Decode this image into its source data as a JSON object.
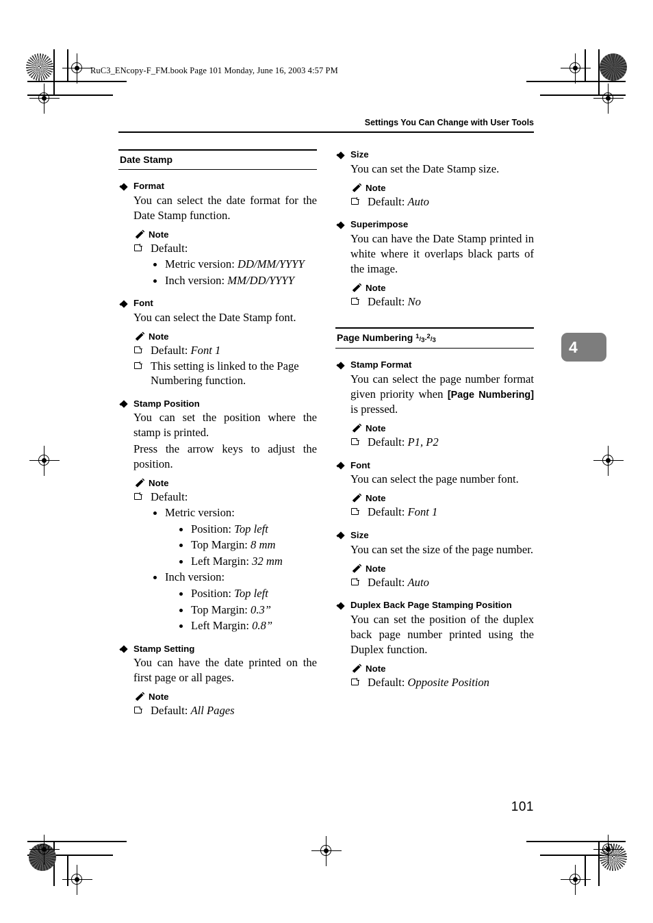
{
  "print_marks": {
    "file_info": "RuC3_ENcopy-F_FM.book  Page 101  Monday, June 16, 2003  4:57 PM"
  },
  "running_head": "Settings You Can Change with User Tools",
  "chapter_tab": "4",
  "folio": "101",
  "labels": {
    "note": "Note",
    "default_prefix": "Default:"
  },
  "left_column": {
    "section_title": "Date Stamp",
    "items": [
      {
        "title": "Format",
        "body": "You can select the date format for the Date Stamp function.",
        "note_lines": [
          "Default:"
        ],
        "sub_bullets": [
          {
            "text": "Metric version: ",
            "value": "DD/MM/YYYY"
          },
          {
            "text": "Inch version: ",
            "value": "MM/DD/YYYY"
          }
        ]
      },
      {
        "title": "Font",
        "body": "You can select the Date Stamp font.",
        "note_lines": [
          "Default: Font 1",
          "This setting is linked to the Page Numbering function."
        ]
      },
      {
        "title": "Stamp Position",
        "body": "You can set the position where the stamp is printed.\nPress the arrow keys to adjust the position.",
        "note_lines": [
          "Default:"
        ]
      },
      {
        "title": "Stamp Setting",
        "body": "You can have the date printed on the first page or all pages.",
        "note_lines": [
          "Default: All Pages"
        ]
      }
    ],
    "format_note_label": "Default:",
    "format_sub": [
      {
        "label": "Metric version: ",
        "value": "DD/MM/YYYY"
      },
      {
        "label": "Inch version: ",
        "value": "MM/DD/YYYY"
      }
    ],
    "font_note_1_label": "Default: ",
    "font_note_1_value": "Font 1",
    "font_note_2": "This setting is linked to the Page Numbering function.",
    "stamp_position_body_1": "You can set the position where the stamp is printed.",
    "stamp_position_body_2": "Press the arrow keys to adjust the position.",
    "stamp_position_default_label": "Default:",
    "stamp_position_versions": [
      {
        "label": "Metric version:",
        "entries": [
          {
            "label": "Position: ",
            "value": "Top left"
          },
          {
            "label": "Top Margin: ",
            "value": "8 mm"
          },
          {
            "label": "Left Margin: ",
            "value": "32 mm"
          }
        ]
      },
      {
        "label": "Inch version:",
        "entries": [
          {
            "label": "Position: ",
            "value": "Top left"
          },
          {
            "label": "Top Margin: ",
            "value": "0.3”"
          },
          {
            "label": "Left Margin: ",
            "value": "0.8”"
          }
        ]
      }
    ],
    "stamp_setting_note_label": "Default: ",
    "stamp_setting_note_value": "All Pages"
  },
  "right_column": {
    "size_title": "Size",
    "size_body": "You can set the Date Stamp size.",
    "size_note_label": "Default: ",
    "size_note_value": "Auto",
    "superimpose_title": "Superimpose",
    "superimpose_body": "You can have the Date Stamp printed in white where it overlaps black parts of the image.",
    "superimpose_note_label": "Default: ",
    "superimpose_note_value": "No",
    "section_title": "Page Numbering",
    "section_title_fraction_1_num": "1",
    "section_title_fraction_1_den": "3",
    "section_title_separator": "-",
    "section_title_fraction_2_num": "2",
    "section_title_fraction_2_den": "3",
    "stamp_format_title": "Stamp Format",
    "stamp_format_body_before": "You can select the page number format given priority when ",
    "stamp_format_body_key": "[Page Numbering]",
    "stamp_format_body_after": " is pressed.",
    "stamp_format_note_label": "Default: ",
    "stamp_format_note_value": "P1, P2",
    "font_title": "Font",
    "font_body": "You can select the page number font.",
    "font_note_label": "Default: ",
    "font_note_value": "Font 1",
    "pn_size_title": "Size",
    "pn_size_body": "You can set the size of the page number.",
    "pn_size_note_label": "Default: ",
    "pn_size_note_value": "Auto",
    "duplex_title": "Duplex Back Page Stamping Position",
    "duplex_body": "You can set the position of the duplex back page number printed using the Duplex function.",
    "duplex_note_label": "Default: ",
    "duplex_note_value": "Opposite Position"
  }
}
